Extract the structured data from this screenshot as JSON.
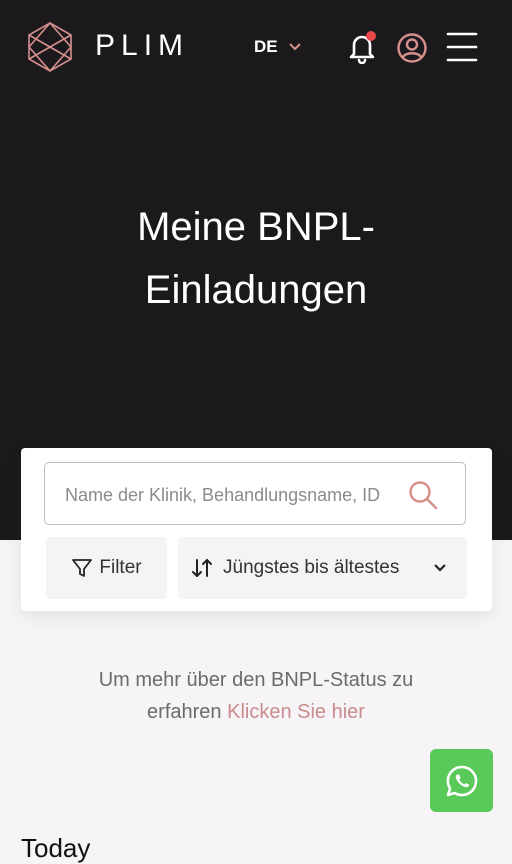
{
  "header": {
    "brand": "PLIM",
    "language": "DE",
    "icons": {
      "logo": "hexagon-diamond-logo",
      "language_chevron": "chevron-down-icon",
      "notifications": "bell-icon",
      "profile": "user-circle-icon",
      "menu": "hamburger-menu-icon"
    },
    "has_unread_notification": true
  },
  "hero": {
    "title_line1": "Meine BNPL-",
    "title_line2": "Einladungen"
  },
  "search": {
    "placeholder": "Name der Klinik, Behandlungsname, ID"
  },
  "filters": {
    "filter_label": "Filter",
    "sort_label": "Jüngstes bis ältestes"
  },
  "info": {
    "line1": "Um mehr über den BNPL-Status zu",
    "line2_prefix": "erfahren",
    "link_text": "Klicken Sie hier"
  },
  "list": {
    "section_heading": "Today"
  },
  "colors": {
    "hero_background": "#1b191c",
    "accent": "#c98b8b",
    "notification_dot": "#e8494d",
    "whatsapp_green": "#59c959",
    "page_background": "#f6f4f6"
  }
}
